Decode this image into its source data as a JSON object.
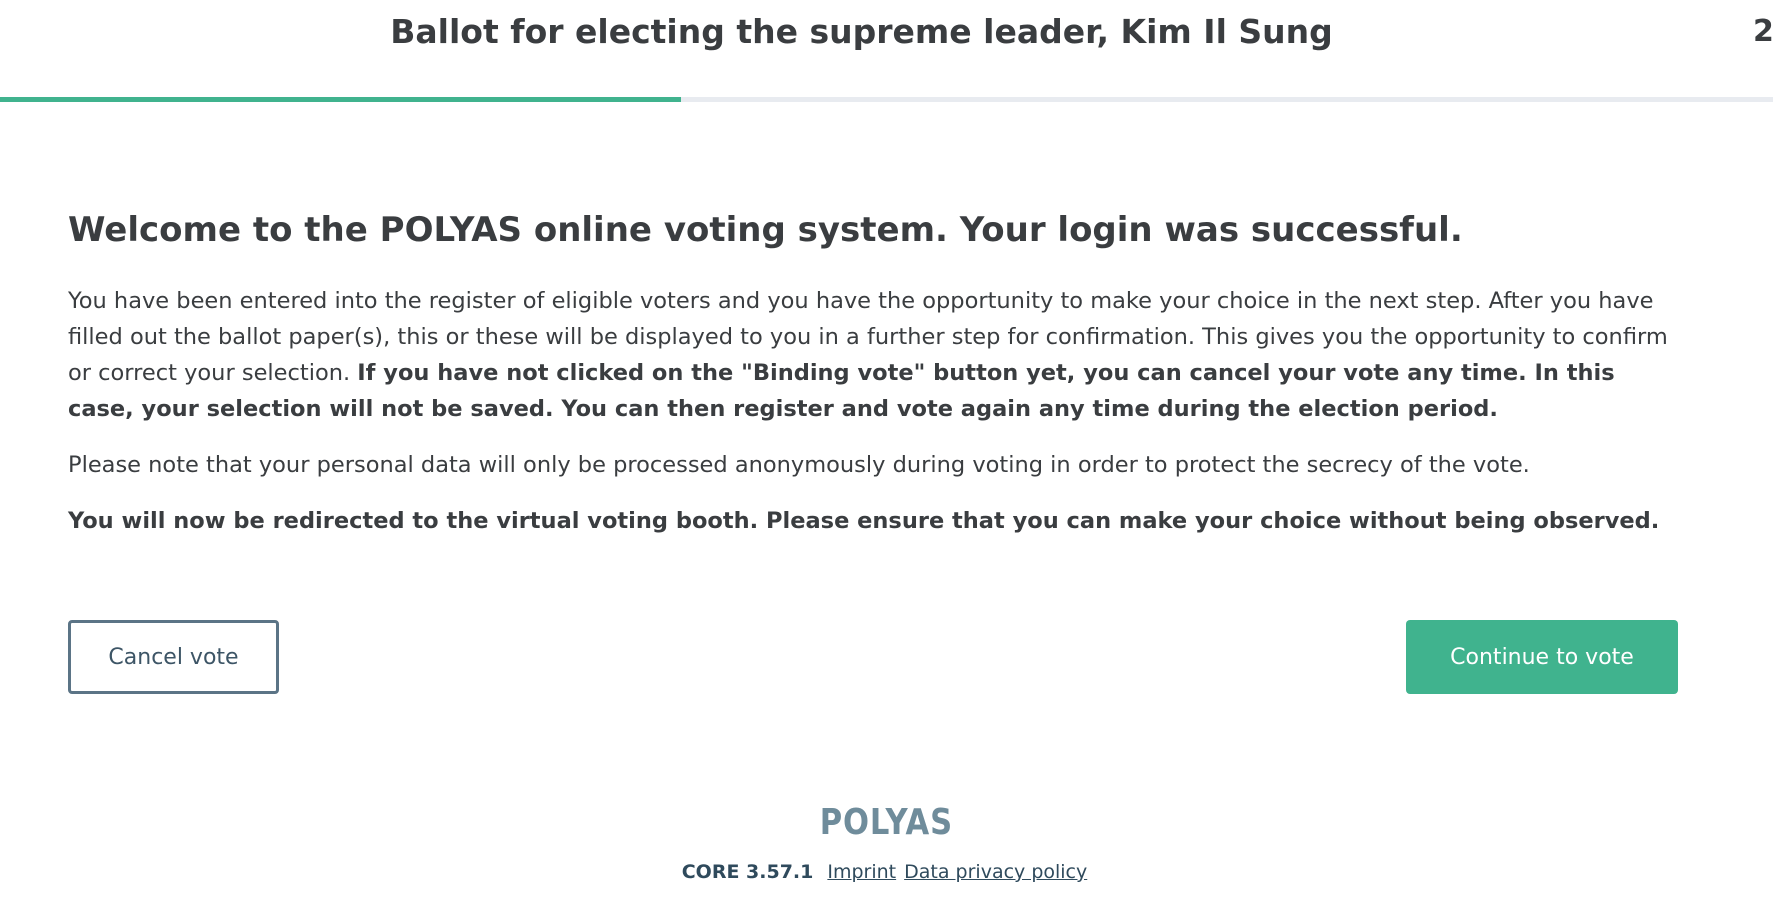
{
  "header": {
    "title": "Ballot for electing the supreme leader, Kim Il Sung",
    "count": "2",
    "progress_fraction": 0.384
  },
  "colors": {
    "accent": "#40b38e",
    "text": "#3a3d40",
    "cancel_border": "#5b7486",
    "logo": "#6f8c9b"
  },
  "main": {
    "heading": "Welcome to the POLYAS online voting system. Your login was successful.",
    "para1_normal": "You have been entered into the register of eligible voters and you have the opportunity to make your choice in the next step. After you have filled out the ballot paper(s), this or these will be displayed to you in a further step for confirmation. This gives you the opportunity to confirm or correct your selection. ",
    "para1_bold": "If you have not clicked on the \"Binding vote\" button yet, you can cancel your vote any time. In this case, your selection will not be saved. You can then register and vote again any time during the election period.",
    "para2": "Please note that your personal data will only be processed anonymously during voting in order to protect the secrecy of the vote.",
    "para3_bold": "You will now be redirected to the virtual voting booth. Please ensure that you can make your choice without being observed."
  },
  "buttons": {
    "cancel_label": "Cancel vote",
    "continue_label": "Continue to vote"
  },
  "footer": {
    "logo_text": "POLYAS",
    "version": "CORE 3.57.1",
    "imprint_label": "Imprint",
    "privacy_label": "Data privacy policy"
  }
}
